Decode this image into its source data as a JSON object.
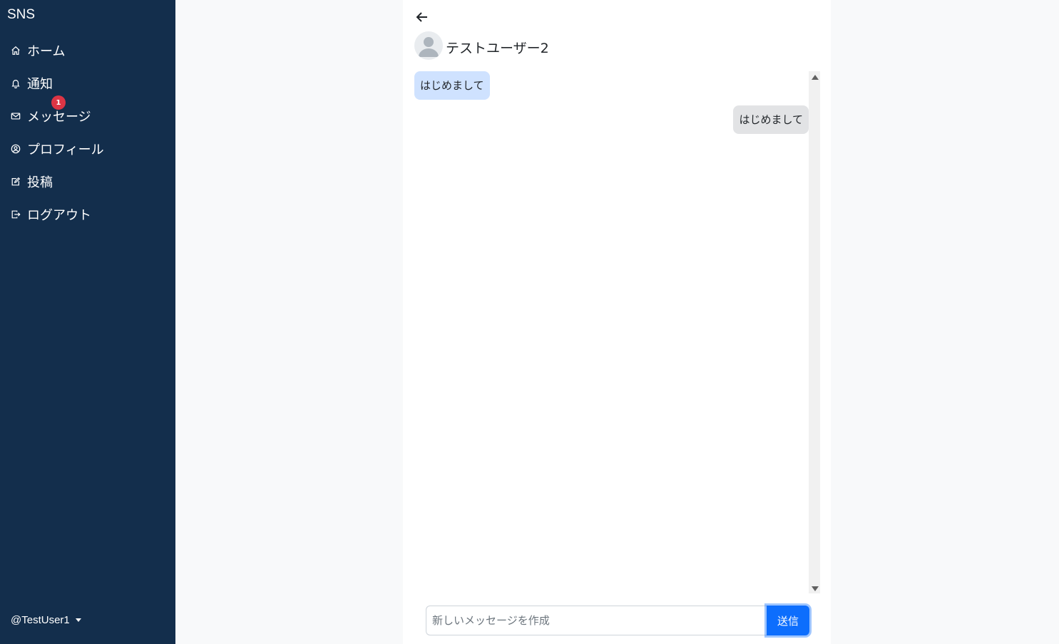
{
  "sidebar": {
    "brand": "SNS",
    "items": [
      {
        "label": "ホーム",
        "icon": "home-icon"
      },
      {
        "label": "通知",
        "icon": "bell-icon",
        "badge": "1"
      },
      {
        "label": "メッセージ",
        "icon": "envelope-icon"
      },
      {
        "label": "プロフィール",
        "icon": "person-circle-icon"
      },
      {
        "label": "投稿",
        "icon": "pencil-square-icon"
      },
      {
        "label": "ログアウト",
        "icon": "box-arrow-right-icon"
      }
    ],
    "user": "@TestUser1"
  },
  "chat": {
    "partner_name": "テストユーザー2",
    "messages": [
      {
        "text": "はじめまして",
        "direction": "incoming"
      },
      {
        "text": "はじめまして",
        "direction": "outgoing"
      }
    ],
    "input_placeholder": "新しいメッセージを作成",
    "input_value": "",
    "send_label": "送信"
  },
  "colors": {
    "sidebar_bg": "#132e4c",
    "badge": "#dc3545",
    "incoming_bubble": "#cfe2ff",
    "outgoing_bubble": "#e2e3e5",
    "primary": "#0d6efd"
  }
}
